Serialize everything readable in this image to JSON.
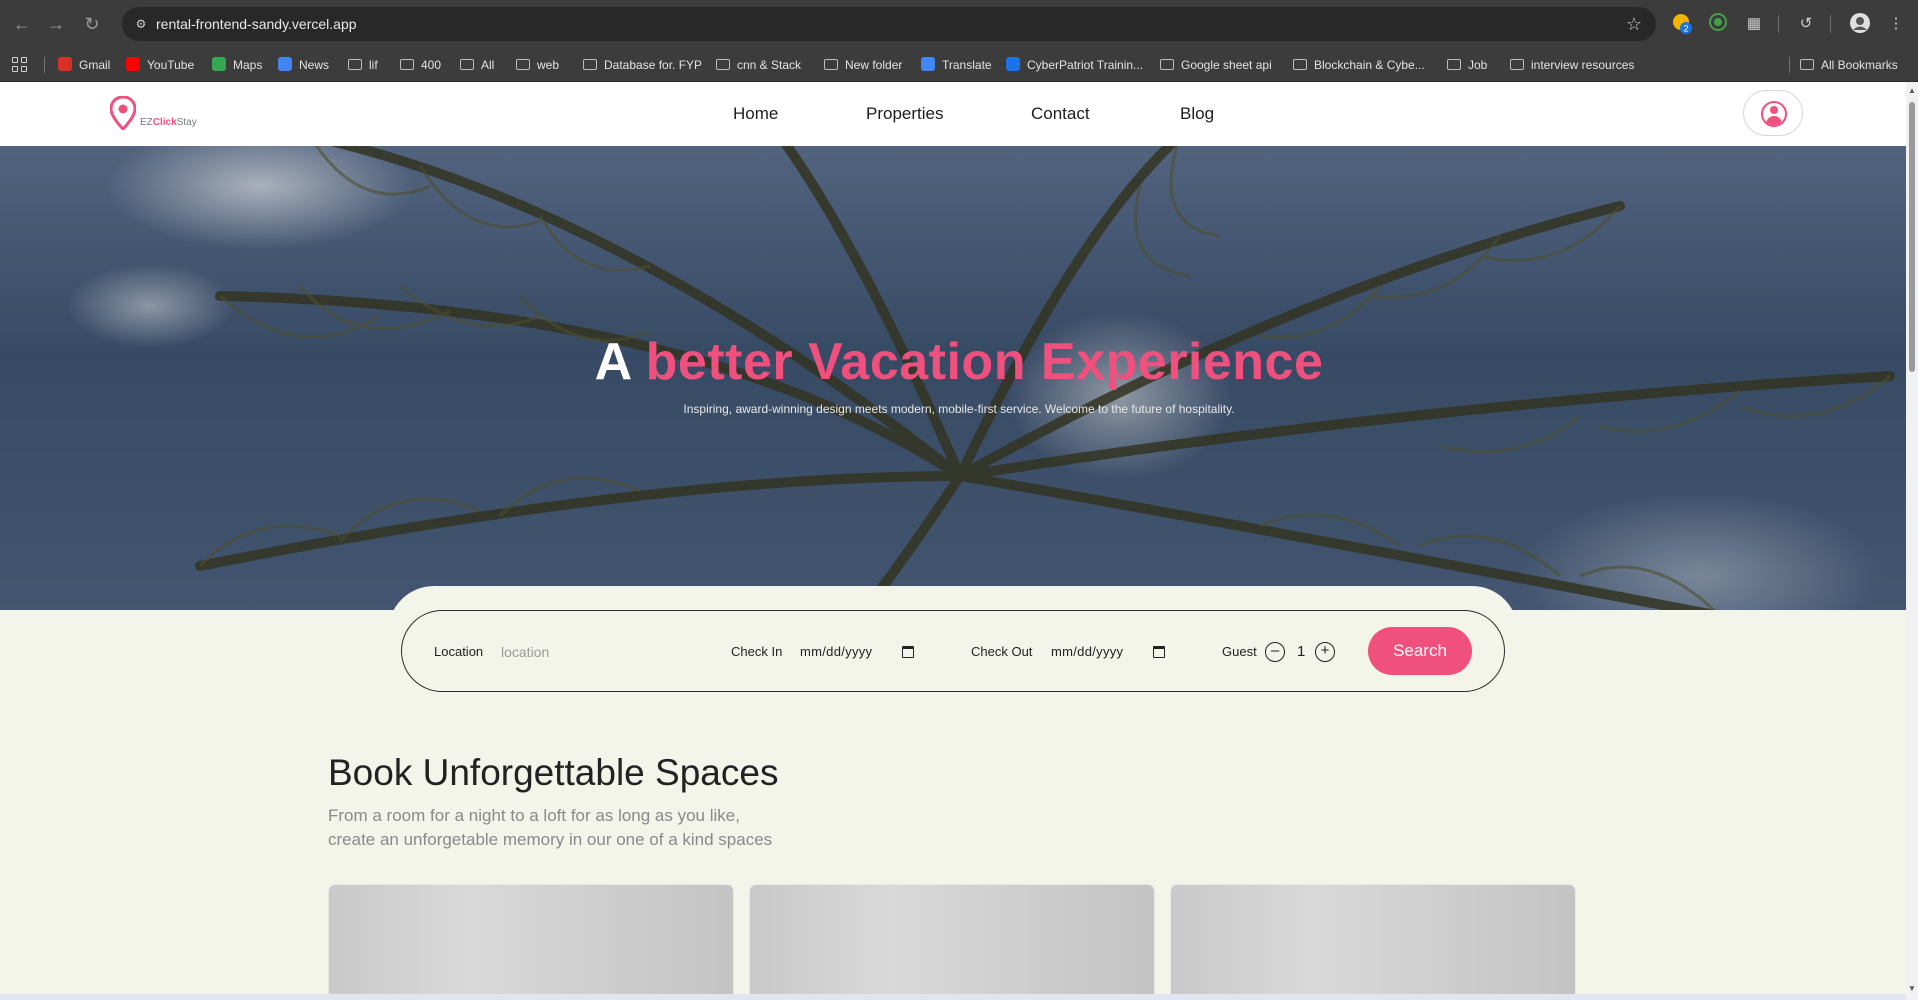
{
  "browser": {
    "url": "rental-frontend-sandy.vercel.app",
    "bookmarks": [
      {
        "label": "Gmail",
        "icon": "gmail-icon",
        "color": "#d93025"
      },
      {
        "label": "YouTube",
        "icon": "youtube-icon",
        "color": "#ff0000"
      },
      {
        "label": "Maps",
        "icon": "maps-icon",
        "color": "#34a853"
      },
      {
        "label": "News",
        "icon": "news-icon",
        "color": "#4285f4"
      },
      {
        "label": "lif",
        "icon": "folder-icon"
      },
      {
        "label": "400",
        "icon": "folder-icon"
      },
      {
        "label": "All",
        "icon": "folder-icon"
      },
      {
        "label": "web",
        "icon": "folder-icon"
      },
      {
        "label": "Database for. FYP",
        "icon": "folder-icon"
      },
      {
        "label": "cnn & Stack",
        "icon": "folder-icon"
      },
      {
        "label": "New folder",
        "icon": "folder-icon"
      },
      {
        "label": "Translate",
        "icon": "translate-icon",
        "color": "#4285f4"
      },
      {
        "label": "CyberPatriot Trainin...",
        "icon": "cyberpatriot-icon",
        "color": "#1a73e8"
      },
      {
        "label": "Google sheet api",
        "icon": "folder-icon"
      },
      {
        "label": "Blockchain & Cybe...",
        "icon": "folder-icon"
      },
      {
        "label": "Job",
        "icon": "folder-icon"
      },
      {
        "label": "interview resources",
        "icon": "folder-icon"
      }
    ],
    "all_bookmarks": "All Bookmarks",
    "extension_badge": "2"
  },
  "header": {
    "logo_prefix": "EZ",
    "logo_bold": "Click",
    "logo_suffix": "Stay",
    "nav": [
      "Home",
      "Properties",
      "Contact",
      "Blog"
    ]
  },
  "hero": {
    "title_lead": "A",
    "title_accent": "better Vacation Experience",
    "subtitle": "Inspiring, award-winning design meets modern, mobile-first service. Welcome to the future of hospitality."
  },
  "search": {
    "location_label": "Location",
    "location_placeholder": "location",
    "checkin_label": "Check In",
    "checkin_value": "mm/dd/yyyy",
    "checkout_label": "Check Out",
    "checkout_value": "mm/dd/yyyy",
    "guest_label": "Guest",
    "guest_count": "1",
    "button": "Search"
  },
  "section": {
    "title": "Book Unforgettable Spaces",
    "subtitle_line1": "From a room for a night to a loft for as long as you like,",
    "subtitle_line2": "create an unforgetable memory in our one of a kind spaces"
  },
  "colors": {
    "accent": "#f0507e",
    "page_bg": "#f3f4ea",
    "chrome_bg": "#3c3c3c"
  }
}
